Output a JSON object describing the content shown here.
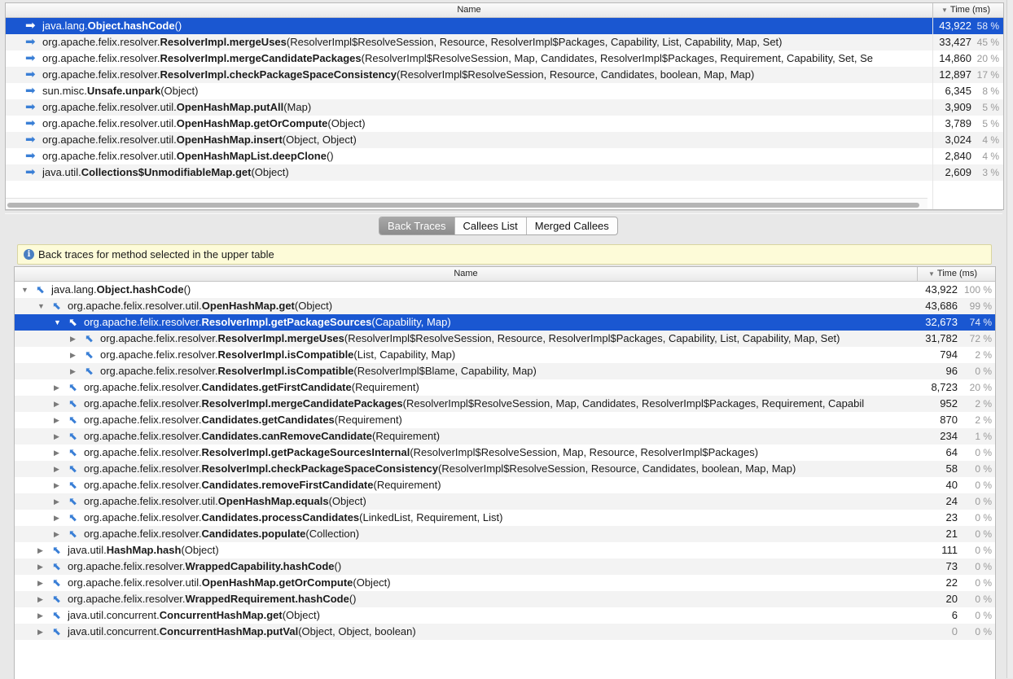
{
  "top_table": {
    "header": {
      "name": "Name",
      "time": "Time (ms)"
    },
    "rows": [
      {
        "pre": "java.lang.",
        "bold": "Object.hashCode",
        "post": "()",
        "ms": "43,922",
        "pct": "58 %"
      },
      {
        "pre": "org.apache.felix.resolver.",
        "bold": "ResolverImpl.mergeUses",
        "post": "(ResolverImpl$ResolveSession, Resource, ResolverImpl$Packages, Capability, List, Capability, Map, Set)",
        "ms": "33,427",
        "pct": "45 %"
      },
      {
        "pre": "org.apache.felix.resolver.",
        "bold": "ResolverImpl.mergeCandidatePackages",
        "post": "(ResolverImpl$ResolveSession, Map, Candidates, ResolverImpl$Packages, Requirement, Capability, Set, Se",
        "ms": "14,860",
        "pct": "20 %"
      },
      {
        "pre": "org.apache.felix.resolver.",
        "bold": "ResolverImpl.checkPackageSpaceConsistency",
        "post": "(ResolverImpl$ResolveSession, Resource, Candidates, boolean, Map, Map)",
        "ms": "12,897",
        "pct": "17 %"
      },
      {
        "pre": "sun.misc.",
        "bold": "Unsafe.unpark",
        "post": "(Object)",
        "ms": "6,345",
        "pct": "8 %"
      },
      {
        "pre": "org.apache.felix.resolver.util.",
        "bold": "OpenHashMap.putAll",
        "post": "(Map)",
        "ms": "3,909",
        "pct": "5 %"
      },
      {
        "pre": "org.apache.felix.resolver.util.",
        "bold": "OpenHashMap.getOrCompute",
        "post": "(Object)",
        "ms": "3,789",
        "pct": "5 %"
      },
      {
        "pre": "org.apache.felix.resolver.util.",
        "bold": "OpenHashMap.insert",
        "post": "(Object, Object)",
        "ms": "3,024",
        "pct": "4 %"
      },
      {
        "pre": "org.apache.felix.resolver.util.",
        "bold": "OpenHashMapList.deepClone",
        "post": "()",
        "ms": "2,840",
        "pct": "4 %"
      },
      {
        "pre": "java.util.",
        "bold": "Collections$UnmodifiableMap.get",
        "post": "(Object)",
        "ms": "2,609",
        "pct": "3 %"
      }
    ]
  },
  "tabs": [
    {
      "label": "Back Traces"
    },
    {
      "label": "Callees List"
    },
    {
      "label": "Merged Callees"
    }
  ],
  "info": {
    "text": "Back traces for method selected in the upper table",
    "icon": "info-icon"
  },
  "bottom_table": {
    "header": {
      "name": "Name",
      "time": "Time (ms)"
    },
    "rows": [
      {
        "level": 0,
        "toggle": "open",
        "pre": "java.lang.",
        "bold": "Object.hashCode",
        "post": "()",
        "ms": "43,922",
        "pct": "100 %"
      },
      {
        "level": 1,
        "toggle": "open",
        "pre": "org.apache.felix.resolver.util.",
        "bold": "OpenHashMap.get",
        "post": "(Object)",
        "ms": "43,686",
        "pct": "99 %"
      },
      {
        "level": 2,
        "toggle": "open",
        "pre": "org.apache.felix.resolver.",
        "bold": "ResolverImpl.getPackageSources",
        "post": "(Capability, Map)",
        "ms": "32,673",
        "pct": "74 %"
      },
      {
        "level": 3,
        "toggle": "closed",
        "pre": "org.apache.felix.resolver.",
        "bold": "ResolverImpl.mergeUses",
        "post": "(ResolverImpl$ResolveSession, Resource, ResolverImpl$Packages, Capability, List, Capability, Map, Set)",
        "ms": "31,782",
        "pct": "72 %"
      },
      {
        "level": 3,
        "toggle": "closed",
        "pre": "org.apache.felix.resolver.",
        "bold": "ResolverImpl.isCompatible",
        "post": "(List, Capability, Map)",
        "ms": "794",
        "pct": "2 %"
      },
      {
        "level": 3,
        "toggle": "closed",
        "pre": "org.apache.felix.resolver.",
        "bold": "ResolverImpl.isCompatible",
        "post": "(ResolverImpl$Blame, Capability, Map)",
        "ms": "96",
        "pct": "0 %"
      },
      {
        "level": 2,
        "toggle": "closed",
        "pre": "org.apache.felix.resolver.",
        "bold": "Candidates.getFirstCandidate",
        "post": "(Requirement)",
        "ms": "8,723",
        "pct": "20 %"
      },
      {
        "level": 2,
        "toggle": "closed",
        "pre": "org.apache.felix.resolver.",
        "bold": "ResolverImpl.mergeCandidatePackages",
        "post": "(ResolverImpl$ResolveSession, Map, Candidates, ResolverImpl$Packages, Requirement, Capabil",
        "ms": "952",
        "pct": "2 %"
      },
      {
        "level": 2,
        "toggle": "closed",
        "pre": "org.apache.felix.resolver.",
        "bold": "Candidates.getCandidates",
        "post": "(Requirement)",
        "ms": "870",
        "pct": "2 %"
      },
      {
        "level": 2,
        "toggle": "closed",
        "pre": "org.apache.felix.resolver.",
        "bold": "Candidates.canRemoveCandidate",
        "post": "(Requirement)",
        "ms": "234",
        "pct": "1 %"
      },
      {
        "level": 2,
        "toggle": "closed",
        "pre": "org.apache.felix.resolver.",
        "bold": "ResolverImpl.getPackageSourcesInternal",
        "post": "(ResolverImpl$ResolveSession, Map, Resource, ResolverImpl$Packages)",
        "ms": "64",
        "pct": "0 %"
      },
      {
        "level": 2,
        "toggle": "closed",
        "pre": "org.apache.felix.resolver.",
        "bold": "ResolverImpl.checkPackageSpaceConsistency",
        "post": "(ResolverImpl$ResolveSession, Resource, Candidates, boolean, Map, Map)",
        "ms": "58",
        "pct": "0 %"
      },
      {
        "level": 2,
        "toggle": "closed",
        "pre": "org.apache.felix.resolver.",
        "bold": "Candidates.removeFirstCandidate",
        "post": "(Requirement)",
        "ms": "40",
        "pct": "0 %"
      },
      {
        "level": 2,
        "toggle": "closed",
        "pre": "org.apache.felix.resolver.util.",
        "bold": "OpenHashMap.equals",
        "post": "(Object)",
        "ms": "24",
        "pct": "0 %"
      },
      {
        "level": 2,
        "toggle": "closed",
        "pre": "org.apache.felix.resolver.",
        "bold": "Candidates.processCandidates",
        "post": "(LinkedList, Requirement, List)",
        "ms": "23",
        "pct": "0 %"
      },
      {
        "level": 2,
        "toggle": "closed",
        "pre": "org.apache.felix.resolver.",
        "bold": "Candidates.populate",
        "post": "(Collection)",
        "ms": "21",
        "pct": "0 %"
      },
      {
        "level": 1,
        "toggle": "closed",
        "pre": "java.util.",
        "bold": "HashMap.hash",
        "post": "(Object)",
        "ms": "111",
        "pct": "0 %"
      },
      {
        "level": 1,
        "toggle": "closed",
        "pre": "org.apache.felix.resolver.",
        "bold": "WrappedCapability.hashCode",
        "post": "()",
        "ms": "73",
        "pct": "0 %"
      },
      {
        "level": 1,
        "toggle": "closed",
        "pre": "org.apache.felix.resolver.util.",
        "bold": "OpenHashMap.getOrCompute",
        "post": "(Object)",
        "ms": "22",
        "pct": "0 %"
      },
      {
        "level": 1,
        "toggle": "closed",
        "pre": "org.apache.felix.resolver.",
        "bold": "WrappedRequirement.hashCode",
        "post": "()",
        "ms": "20",
        "pct": "0 %"
      },
      {
        "level": 1,
        "toggle": "closed",
        "pre": "java.util.concurrent.",
        "bold": "ConcurrentHashMap.get",
        "post": "(Object)",
        "ms": "6",
        "pct": "0 %"
      },
      {
        "level": 1,
        "toggle": "closed",
        "pre": "java.util.concurrent.",
        "bold": "ConcurrentHashMap.putVal",
        "post": "(Object, Object, boolean)",
        "ms": "0",
        "pct": "0 %"
      }
    ]
  },
  "selection": {
    "top_row": 0,
    "bottom_row": 2
  },
  "colors": {
    "selection": "#1a57d1",
    "icon_blue": "#3a7fd6",
    "info_bg": "#fdfbd8"
  }
}
